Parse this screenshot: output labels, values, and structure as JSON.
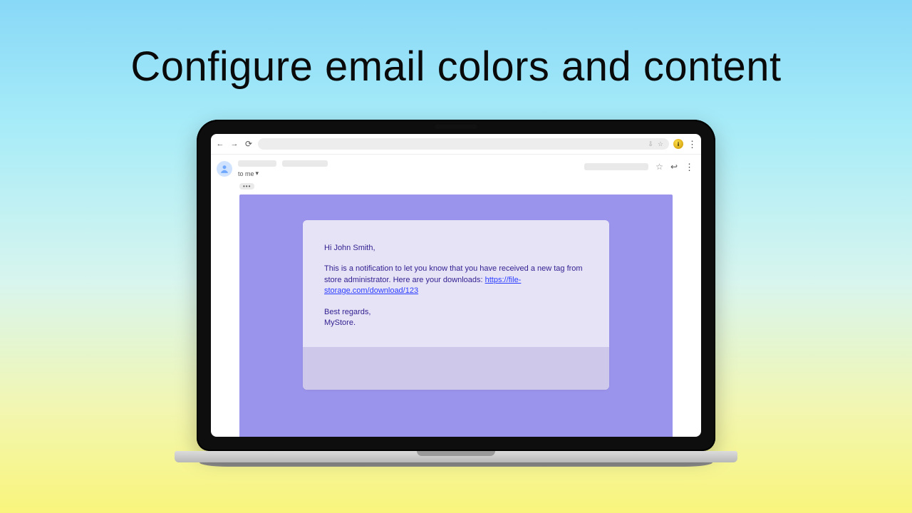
{
  "headline": "Configure email colors and content",
  "browser": {
    "to_me": "to me",
    "dropdown_glyph": "▾",
    "ellipsis": "•••",
    "share_icon": "⇩",
    "starline_icon": "☆",
    "profile_letter": "i"
  },
  "email": {
    "greeting": "Hi John Smith,",
    "body_pre": "This is a notification to let you know that you have received a new tag from store administrator. Here are your downloads: ",
    "link_text": "https://file-storage.com/download/123",
    "signoff_line1": "Best regards,",
    "signoff_line2": "MyStore."
  },
  "colors": {
    "email_bg": "#9b94ec",
    "card_bg": "#e6e3f7",
    "card_footer_bg": "#cec9eb",
    "text_color": "#311f8f"
  }
}
